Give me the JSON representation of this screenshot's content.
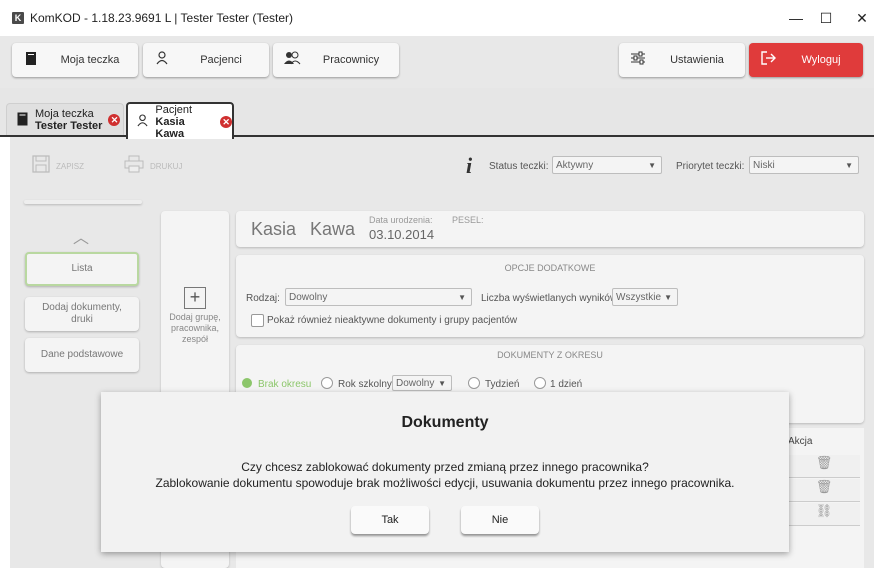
{
  "window": {
    "app_icon": "K",
    "title": "KomKOD - 1.18.23.9691 L | Tester Tester (Tester)",
    "minimize": "—",
    "maximize": "☐",
    "close": "✕"
  },
  "topnav": {
    "folder_label": "Moja teczka",
    "patients_label": "Pacjenci",
    "staff_label": "Pracownicy",
    "settings_label": "Ustawienia",
    "logout_label": "Wyloguj"
  },
  "tabs": [
    {
      "line1": "Moja teczka",
      "line2": "Tester Tester"
    },
    {
      "line1": "Pacjent",
      "line2": "Kasia Kawa"
    }
  ],
  "toolbar": {
    "save_label": "ZAPISZ",
    "print_label": "DRUKUJ",
    "status_label": "Status teczki:",
    "status_value": "Aktywny",
    "priority_label": "Priorytet teczki:",
    "priority_value": "Niski"
  },
  "sidebar": {
    "items": [
      "Lista",
      "Dodaj dokumenty, druki",
      "Dane podstawowe"
    ]
  },
  "add_panel": {
    "label": "Dodaj grupę, pracownika, zespół"
  },
  "patient": {
    "first_name": "Kasia",
    "last_name": "Kawa",
    "dob_label": "Data urodzenia:",
    "dob_value": "03.10.2014",
    "pesel_label": "PESEL:"
  },
  "options": {
    "header": "OPCJE DODATKOWE",
    "type_label": "Rodzaj:",
    "type_value": "Dowolny",
    "results_label": "Liczba wyświetlanych wyników:",
    "results_value": "Wszystkie",
    "inactive_label": "Pokaż również nieaktywne dokumenty i grupy pacjentów"
  },
  "period": {
    "header": "DOKUMENTY Z OKRESU",
    "no_period": "Brak okresu",
    "school_year": "Rok szkolny:",
    "school_year_value": "Dowolny",
    "week": "Tydzień",
    "one_day": "1 dzień"
  },
  "table": {
    "action_header": "Akcja"
  },
  "modal": {
    "title": "Dokumenty",
    "line1": "Czy chcesz zablokować dokumenty przed zmianą przez innego pracownika?",
    "line2": "Zablokowanie dokumentu spowoduje brak możliwości edycji, usuwania dokumentu przez innego pracownika.",
    "yes_label": "Tak",
    "no_label": "Nie"
  },
  "colors": {
    "logout_red": "#e03b3b",
    "active_green": "#b9d8a0",
    "radio_green": "#8cc66b"
  }
}
